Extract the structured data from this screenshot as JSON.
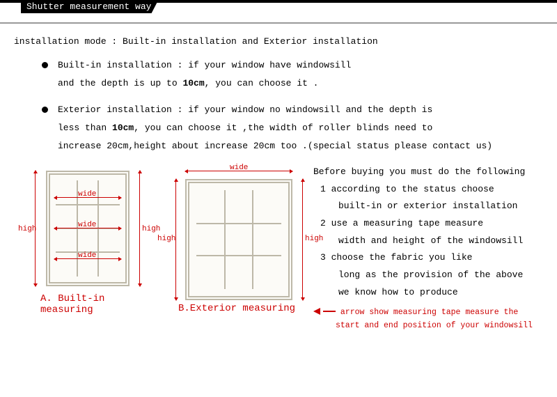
{
  "header": {
    "title": "Shutter measurement way"
  },
  "mode_line": "installation mode : Built-in installation and Exterior installation",
  "builtin": {
    "line1": "Built-in installation : if your window have windowsill",
    "line2a": "and the depth is up to ",
    "depth": "10cm",
    "line2b": ", you can choose it ."
  },
  "exterior": {
    "line1": "Exterior installation : if your window no windowsill and the depth is",
    "line2a": "less than ",
    "depth": "10cm",
    "line2b": ", you can choose it ,the width of roller blinds need to",
    "line3": "increase 20cm,height about increase 20cm too .(special status please contact us)"
  },
  "diagram": {
    "wide": "wide",
    "high": "high",
    "caption_a": "A. Built-in measuring",
    "caption_b": "B.Exterior measuring"
  },
  "instructions": {
    "intro": "Before buying you must do the following",
    "s1": "1 according to the status choose",
    "s1b": "built-in or exterior installation",
    "s2": "2 use a measuring tape measure",
    "s2b": "width and height of the windowsill",
    "s3": "3 choose the fabric you like",
    "s3b": "long as the provision of the above",
    "s3c": "we know how to produce",
    "arrow1": "arrow show measuring tape measure the",
    "arrow2": "start and end position of your windowsill"
  }
}
